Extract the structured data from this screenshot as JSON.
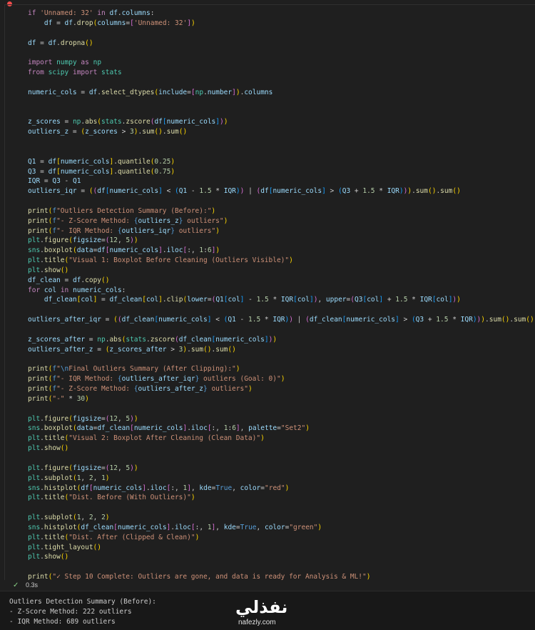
{
  "status": {
    "check_icon": "check-icon",
    "exec_time": "0.3s"
  },
  "output": {
    "lines": [
      "Outliers Detection Summary (Before):",
      "- Z-Score Method: 222 outliers",
      "- IQR Method: 689 outliers"
    ]
  },
  "watermark": {
    "arabic": "نفذلي",
    "latin": "nafezly.com"
  },
  "colors": {
    "run_indicator": "#f14c4c",
    "success": "#89d185",
    "background": "#1f1f1f"
  }
}
